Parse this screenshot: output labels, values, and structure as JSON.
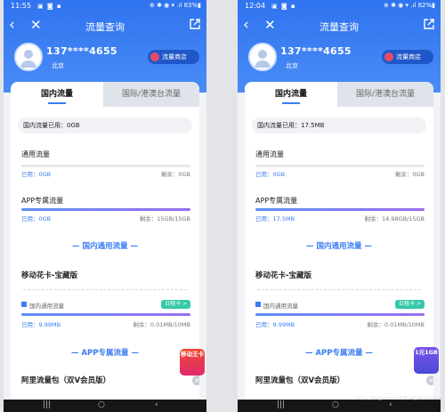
{
  "phones": [
    {
      "status_time": "11:55",
      "status_right": "⊕ ✱ ◉ ▾ .ıl 83%▮",
      "title": "流量查询",
      "phone_number": "137****4655",
      "city": "北京",
      "shop_label": "流量商店",
      "tab_active": "国内流量",
      "tab_inactive": "国际/港澳台流量",
      "used_total": "国内流量已用：0GB",
      "general_title": "通用流量",
      "general_used": "已用：0GB",
      "general_remain": "剩余：0GB",
      "app_title": "APP专属流量",
      "app_used": "已用：0GB",
      "app_remain": "剩余：15GB/15GB",
      "general_section": "国内通用流量",
      "pkg1_name": "移动花卡-宝藏版",
      "pkg1_sub": "国内通用流量",
      "pkg1_tag": "日租卡 >",
      "pkg1_used": "已用：9.99MB",
      "pkg1_remain": "剩余：0.01MB/10MB",
      "app_section": "APP专属流量",
      "pkg2_name": "阿里流量包（双V会员版）",
      "badge_text": "移动王卡"
    },
    {
      "status_time": "12:04",
      "status_right": "⊕ ✱ ◉ ▾ .ıl 82%▮",
      "title": "流量查询",
      "phone_number": "137****4655",
      "city": "北京",
      "shop_label": "流量商店",
      "tab_active": "国内流量",
      "tab_inactive": "国际/港澳台流量",
      "used_total": "国内流量已用：17.5MB",
      "general_title": "通用流量",
      "general_used": "已用：0GB",
      "general_remain": "剩余：0GB",
      "app_title": "APP专属流量",
      "app_used": "已用：17.5MB",
      "app_remain": "剩余：14.98GB/15GB",
      "general_section": "国内通用流量",
      "pkg1_name": "移动花卡-宝藏版",
      "pkg1_sub": "国内通用流量",
      "pkg1_tag": "日租卡 >",
      "pkg1_used": "已用：9.99MB",
      "pkg1_remain": "剩余：0.01MB/10MB",
      "app_section": "APP专属流量",
      "pkg2_name": "阿里流量包（双V会员版）",
      "badge_text": "1元1GB"
    }
  ],
  "colors": {
    "header": "#2f73f0",
    "accent": "#3b7df2",
    "tag": "#34c8a8"
  },
  "watermark": "https://blog.csdn.net/RoadyShowShow"
}
